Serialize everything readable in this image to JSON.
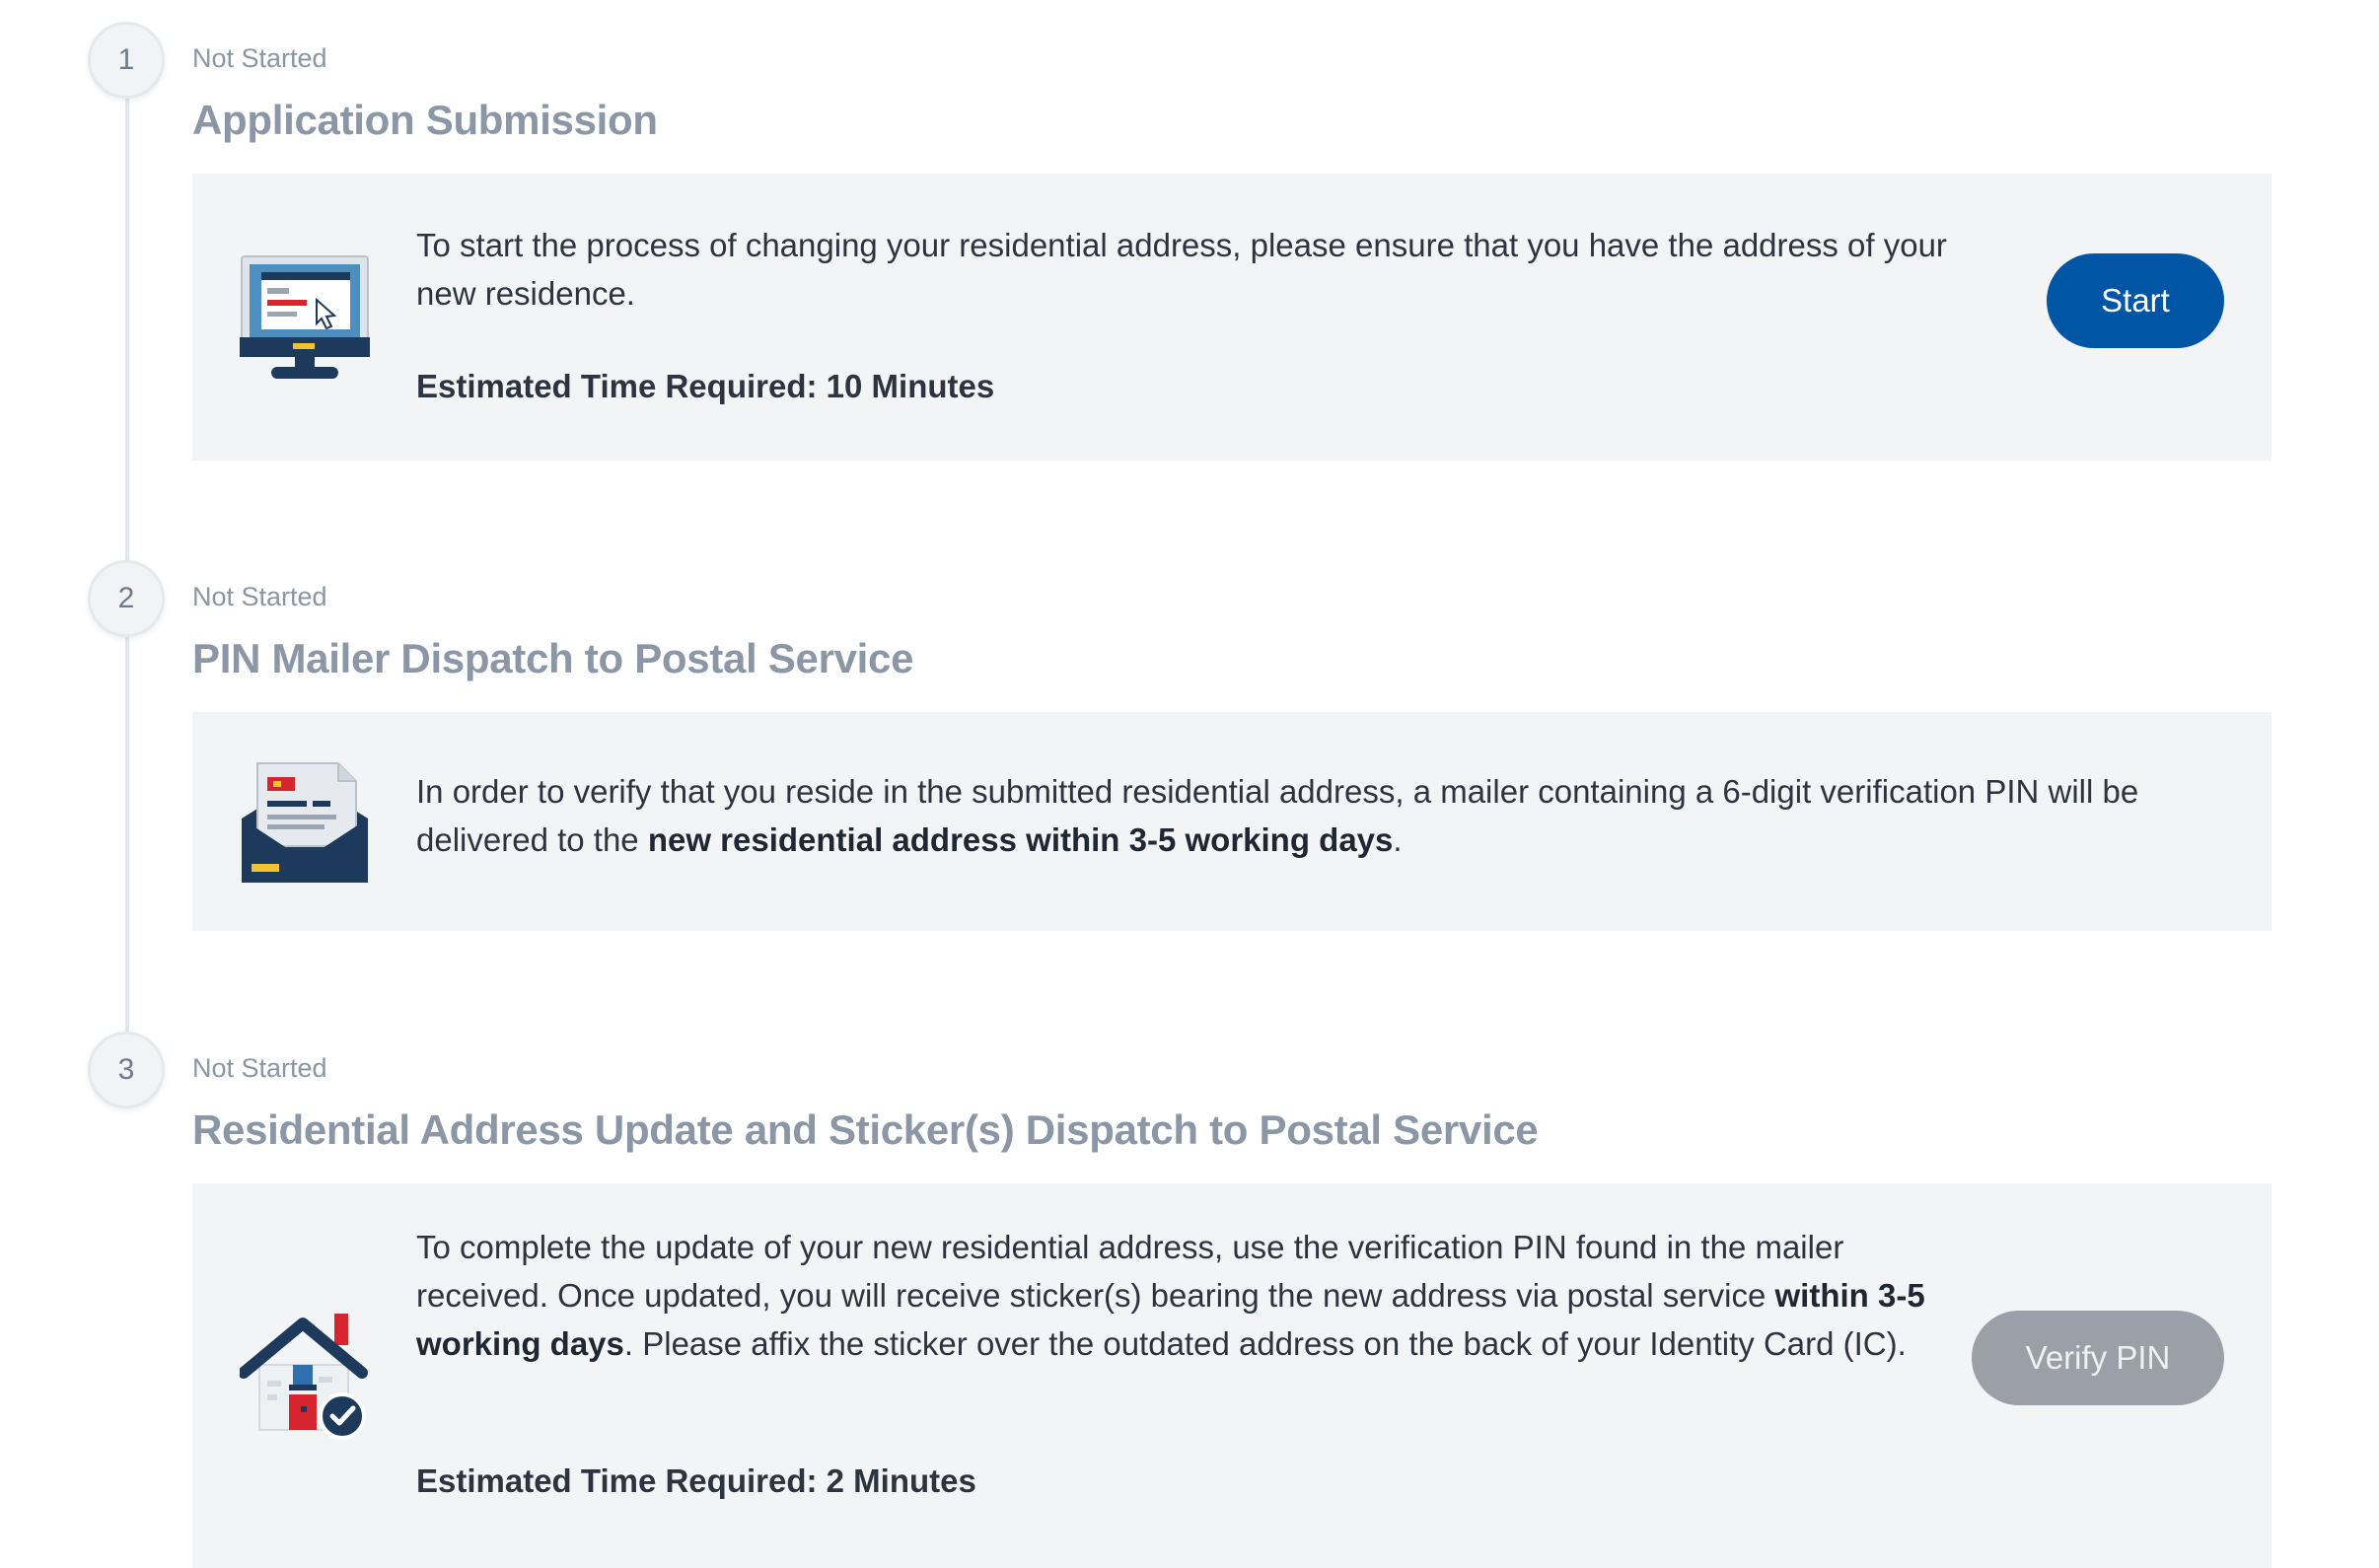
{
  "steps": [
    {
      "number": "1",
      "status": "Not Started",
      "title": "Application Submission",
      "desc": "To start the process of changing your residential address, please ensure that you have the address of your new residence.",
      "estimated": "Estimated Time Required: 10 Minutes",
      "button": "Start",
      "icon": "computer-icon"
    },
    {
      "number": "2",
      "status": "Not Started",
      "title": "PIN Mailer Dispatch to Postal Service",
      "desc_pre": "In order to verify that you reside in the submitted residential address, a mailer containing a 6-digit verification PIN will be delivered to the ",
      "desc_bold": "new residential address within 3-5 working days",
      "desc_post": ".",
      "icon": "mail-envelope-icon"
    },
    {
      "number": "3",
      "status": "Not Started",
      "title": "Residential Address Update and Sticker(s) Dispatch to Postal Service",
      "desc_pre": "To complete the update of your new residential address, use the verification PIN found in the mailer received. Once updated, you will receive sticker(s) bearing the new address via postal service ",
      "desc_bold": "within 3-5 working days",
      "desc_post": ". Please affix the sticker over the outdated address on the back of your Identity Card (IC).",
      "estimated": "Estimated Time Required: 2 Minutes",
      "button": "Verify PIN",
      "icon": "house-check-icon"
    }
  ],
  "colors": {
    "primary": "#0055a5",
    "disabled": "#9aa0a7",
    "panel": "#f3f4f6",
    "title": "#8b97a6",
    "illustration_navy": "#1d3a5c",
    "illustration_red": "#d6252f",
    "illustration_yellow": "#f2c230"
  }
}
